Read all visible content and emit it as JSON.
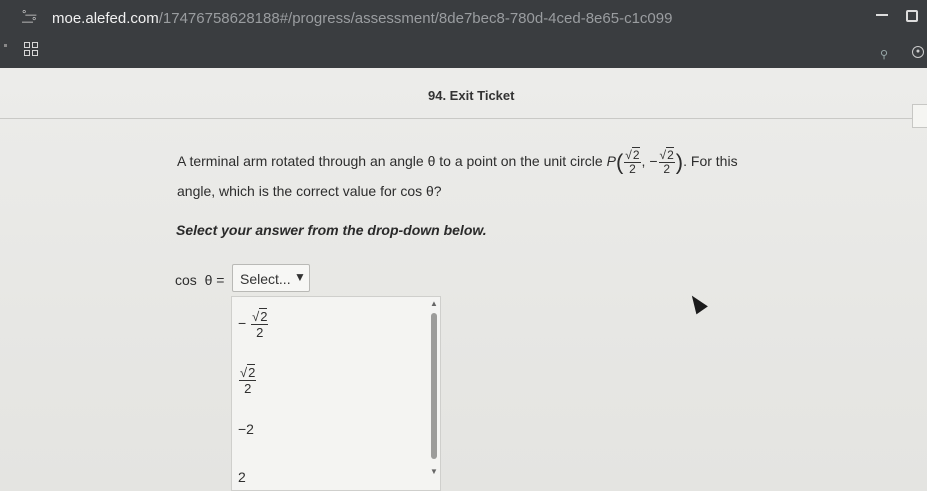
{
  "browser": {
    "url_host": "moe.alefed.com",
    "url_path": "/17476758628188#/progress/assessment/8de7bec8-780d-4ced-8e65-c1c099",
    "site_icon": "tune-icon",
    "apps_icon": "grid-icon"
  },
  "page": {
    "title": "94. Exit Ticket",
    "question_part1": "A terminal arm rotated through an angle θ to a point on the unit circle",
    "point_label": "P",
    "point": {
      "x_sign": "",
      "x_num": "2",
      "x_den": "2",
      "y_sign": "−",
      "y_num": "2",
      "y_den": "2",
      "open": "(",
      "comma": ",",
      "close": ")"
    },
    "question_part2": ". For this",
    "question_part3": "angle, which is the correct value for cos θ?",
    "instruction": "Select your answer from the drop-down below.",
    "answer_label": "cos  θ =",
    "select": {
      "value": "Select...",
      "options": [
        {
          "sign": "−",
          "num": "2",
          "den": "2"
        },
        {
          "sign": "",
          "num": "2",
          "den": "2"
        },
        {
          "text": "−2"
        },
        {
          "text": "2"
        }
      ]
    }
  },
  "colors": {
    "topbar": "#3a3d40",
    "page_bg": "#e9e9e6"
  }
}
